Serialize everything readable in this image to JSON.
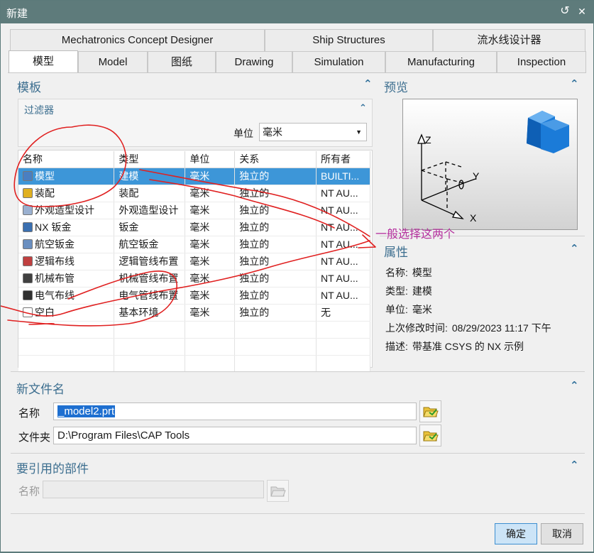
{
  "window": {
    "title": "新建",
    "restore_glyph": "↺",
    "close_glyph": "✕"
  },
  "tabs_row1": [
    "Mechatronics Concept Designer",
    "Ship Structures",
    "流水线设计器"
  ],
  "tabs_row2": [
    "模型",
    "Model",
    "图纸",
    "Drawing",
    "Simulation",
    "Manufacturing",
    "Inspection"
  ],
  "templates": {
    "title": "模板",
    "filter_title": "过滤器",
    "unit_label": "单位",
    "unit_value": "毫米",
    "columns": [
      "名称",
      "类型",
      "单位",
      "关系",
      "所有者"
    ],
    "rows": [
      {
        "name": "模型",
        "type": "建模",
        "unit": "毫米",
        "rel": "独立的",
        "owner": "BUILTI...",
        "icon": "model-icon",
        "color": "#4a7fc1",
        "selected": true
      },
      {
        "name": "装配",
        "type": "装配",
        "unit": "毫米",
        "rel": "独立的",
        "owner": "NT AU...",
        "icon": "assembly-icon",
        "color": "#e0b020",
        "selected": false
      },
      {
        "name": "外观造型设计",
        "type": "外观造型设计",
        "unit": "毫米",
        "rel": "独立的",
        "owner": "NT AU...",
        "icon": "shape-design-icon",
        "color": "#9ab0d0",
        "selected": false
      },
      {
        "name": "NX 钣金",
        "type": "钣金",
        "unit": "毫米",
        "rel": "独立的",
        "owner": "NT AU...",
        "icon": "sheet-metal-icon",
        "color": "#3a6fb0",
        "selected": false
      },
      {
        "name": "航空钣金",
        "type": "航空钣金",
        "unit": "毫米",
        "rel": "独立的",
        "owner": "NT AU...",
        "icon": "aero-sheet-metal-icon",
        "color": "#6a8fc0",
        "selected": false
      },
      {
        "name": "逻辑布线",
        "type": "逻辑管线布置",
        "unit": "毫米",
        "rel": "独立的",
        "owner": "NT AU...",
        "icon": "logical-routing-icon",
        "color": "#c04040",
        "selected": false
      },
      {
        "name": "机械布管",
        "type": "机械管线布置",
        "unit": "毫米",
        "rel": "独立的",
        "owner": "NT AU...",
        "icon": "mechanical-routing-icon",
        "color": "#404040",
        "selected": false
      },
      {
        "name": "电气布线",
        "type": "电气管线布置",
        "unit": "毫米",
        "rel": "独立的",
        "owner": "NT AU...",
        "icon": "electrical-routing-icon",
        "color": "#303030",
        "selected": false
      },
      {
        "name": "空白",
        "type": "基本环境",
        "unit": "毫米",
        "rel": "独立的",
        "owner": "无",
        "icon": "blank-icon",
        "color": "#ffffff",
        "selected": false
      }
    ]
  },
  "preview": {
    "title": "预览",
    "axis_x": "X",
    "axis_y": "Y",
    "axis_z": "Z"
  },
  "properties": {
    "title": "属性",
    "items": [
      {
        "label": "名称:",
        "value": "模型"
      },
      {
        "label": "类型:",
        "value": "建模"
      },
      {
        "label": "单位:",
        "value": "毫米"
      },
      {
        "label": "上次修改时间:",
        "value": "08/29/2023 11:17 下午"
      },
      {
        "label": "描述:",
        "value": "带基准 CSYS 的 NX 示例"
      }
    ]
  },
  "annotation": {
    "text": "一般选择这两个",
    "color": "#b5309e"
  },
  "new_file": {
    "title": "新文件名",
    "name_label": "名称",
    "name_value": "_model2.prt",
    "folder_label": "文件夹",
    "folder_value": "D:\\Program Files\\CAP Tools"
  },
  "ref_parts": {
    "title": "要引用的部件",
    "name_label": "名称",
    "name_value": ""
  },
  "buttons": {
    "ok": "确定",
    "cancel": "取消"
  },
  "colors": {
    "accent": "#3d96d8",
    "section_title": "#3c6e8f",
    "titlebar": "#5e7b7b",
    "ink": "#e02020"
  }
}
